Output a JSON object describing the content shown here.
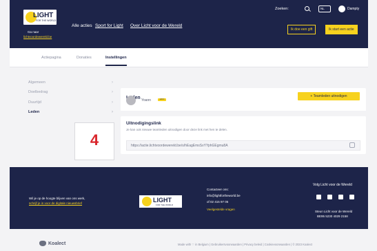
{
  "header": {
    "logo_main": "LIGHT",
    "logo_sub": "FOR THE WORLD",
    "back_label": "Ga naar",
    "back_link": "lichtvoordewereld.be",
    "nav": [
      "Alle acties",
      "Sport for Light",
      "Over Licht voor de Wereld"
    ],
    "search_label": "Zoeken:",
    "language": "NL",
    "user_name": "Dampty",
    "give_button": "Ik doe een gift",
    "start_button": "Ik start een actie"
  },
  "tabs": [
    "Actiepagina",
    "Donaties",
    "Instellingen"
  ],
  "sidebar": [
    "Algemeen",
    "Doelbedrag",
    "Duurtijd",
    "Leden"
  ],
  "members_card": {
    "title": "Leden",
    "invite_button": "+ Teamleden uitnodigen",
    "member_name": "Yoann",
    "member_badge": "admin"
  },
  "invite_card": {
    "title": "Uitnodigingslink",
    "description": "Je kan ook nieuwe teamleden uitnodigen door deze link met hen te delen.",
    "link": "https://actie.lichtvoordewereld.be/s/hEagEmsSxYYphGEgmu8A"
  },
  "step_number": "4",
  "footer": {
    "newsletter_text": "Wil je op de hoogte blijven van ons werk,",
    "newsletter_link": "schrijf je in voor de digitale nieuwsbrief",
    "logo_main": "LIGHT",
    "logo_sub": "FOR THE WORLD",
    "contact_label": "Contacteer ons:",
    "contact_email": "info@lightfortheworld.be",
    "contact_phone": "of 02 415 97 05",
    "faq": "Veelgestelde vragen",
    "follow": "Volg Licht voor de Wereld",
    "support": "Steun Licht voor de Wereld",
    "iban": "BE95 5230 4029 2158"
  },
  "bottom": {
    "brand": "Koalect",
    "legal": "Made with ♡ in Belgium  |  Gebruikersvoorwaarden  |  Privacy beleid  |  Cookievoorwaarden  |  © 2023 Koalect"
  }
}
